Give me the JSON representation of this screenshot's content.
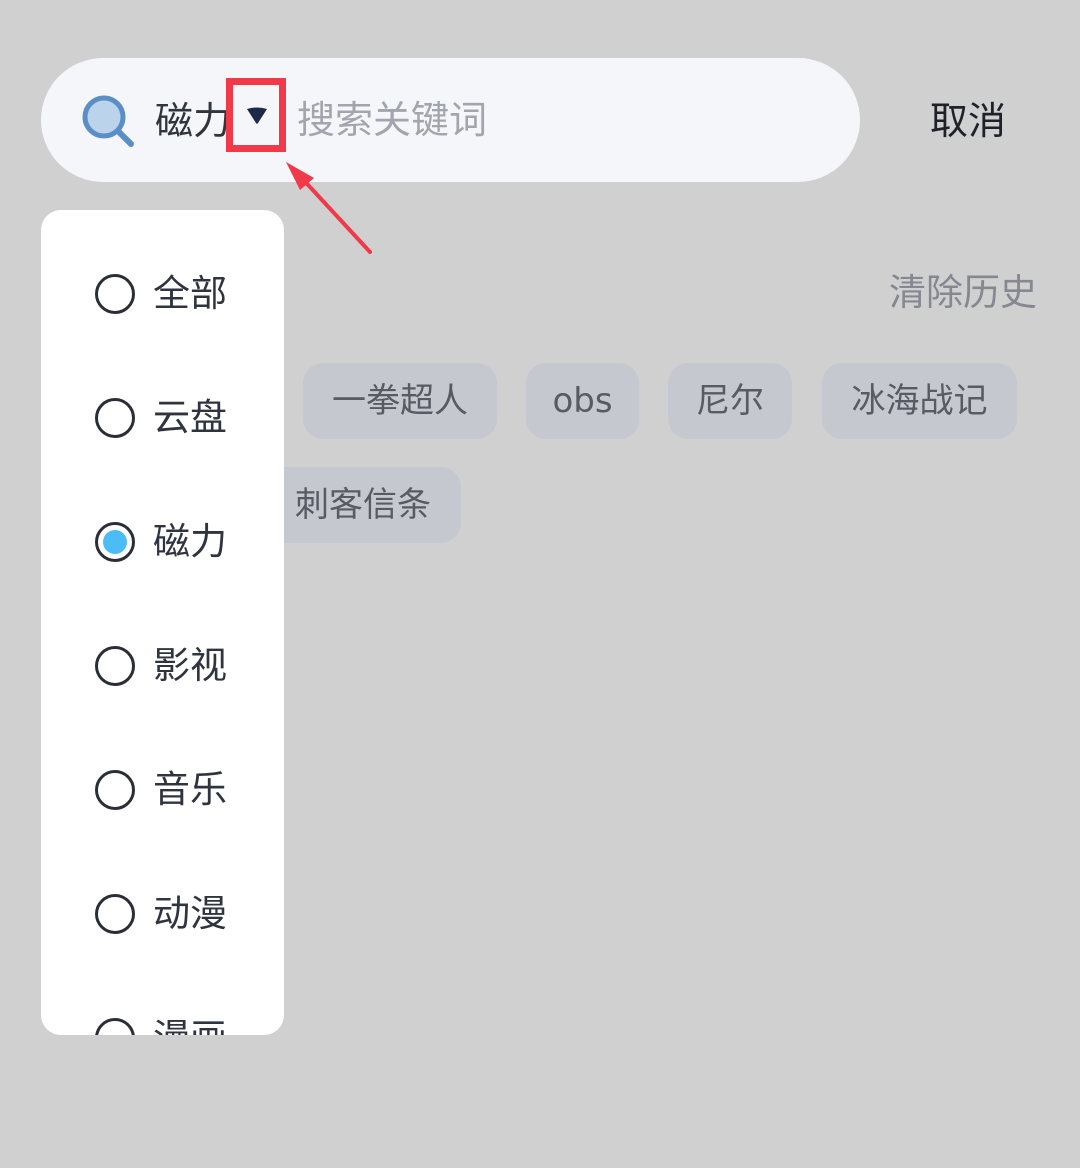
{
  "search": {
    "scope_label": "磁力",
    "placeholder": "搜索关键词",
    "value": "",
    "cancel_label": "取消"
  },
  "history": {
    "clear_label": "清除历史",
    "tags": [
      "一拳超人",
      "obs",
      "尼尔",
      "冰海战记",
      "刺客信条"
    ]
  },
  "dropdown": {
    "options": [
      {
        "label": "全部",
        "selected": false
      },
      {
        "label": "云盘",
        "selected": false
      },
      {
        "label": "磁力",
        "selected": true
      },
      {
        "label": "影视",
        "selected": false
      },
      {
        "label": "音乐",
        "selected": false
      },
      {
        "label": "动漫",
        "selected": false
      },
      {
        "label": "漫画",
        "selected": false
      }
    ]
  },
  "colors": {
    "overlay_background": "#d0d0d0",
    "radio_selected": "#4bbcf5",
    "annotation_highlight": "#f2394a"
  },
  "icons": {
    "search": "search-icon",
    "dropdown_toggle": "caret-down-icon",
    "annotation": "arrow-pointer-icon"
  }
}
